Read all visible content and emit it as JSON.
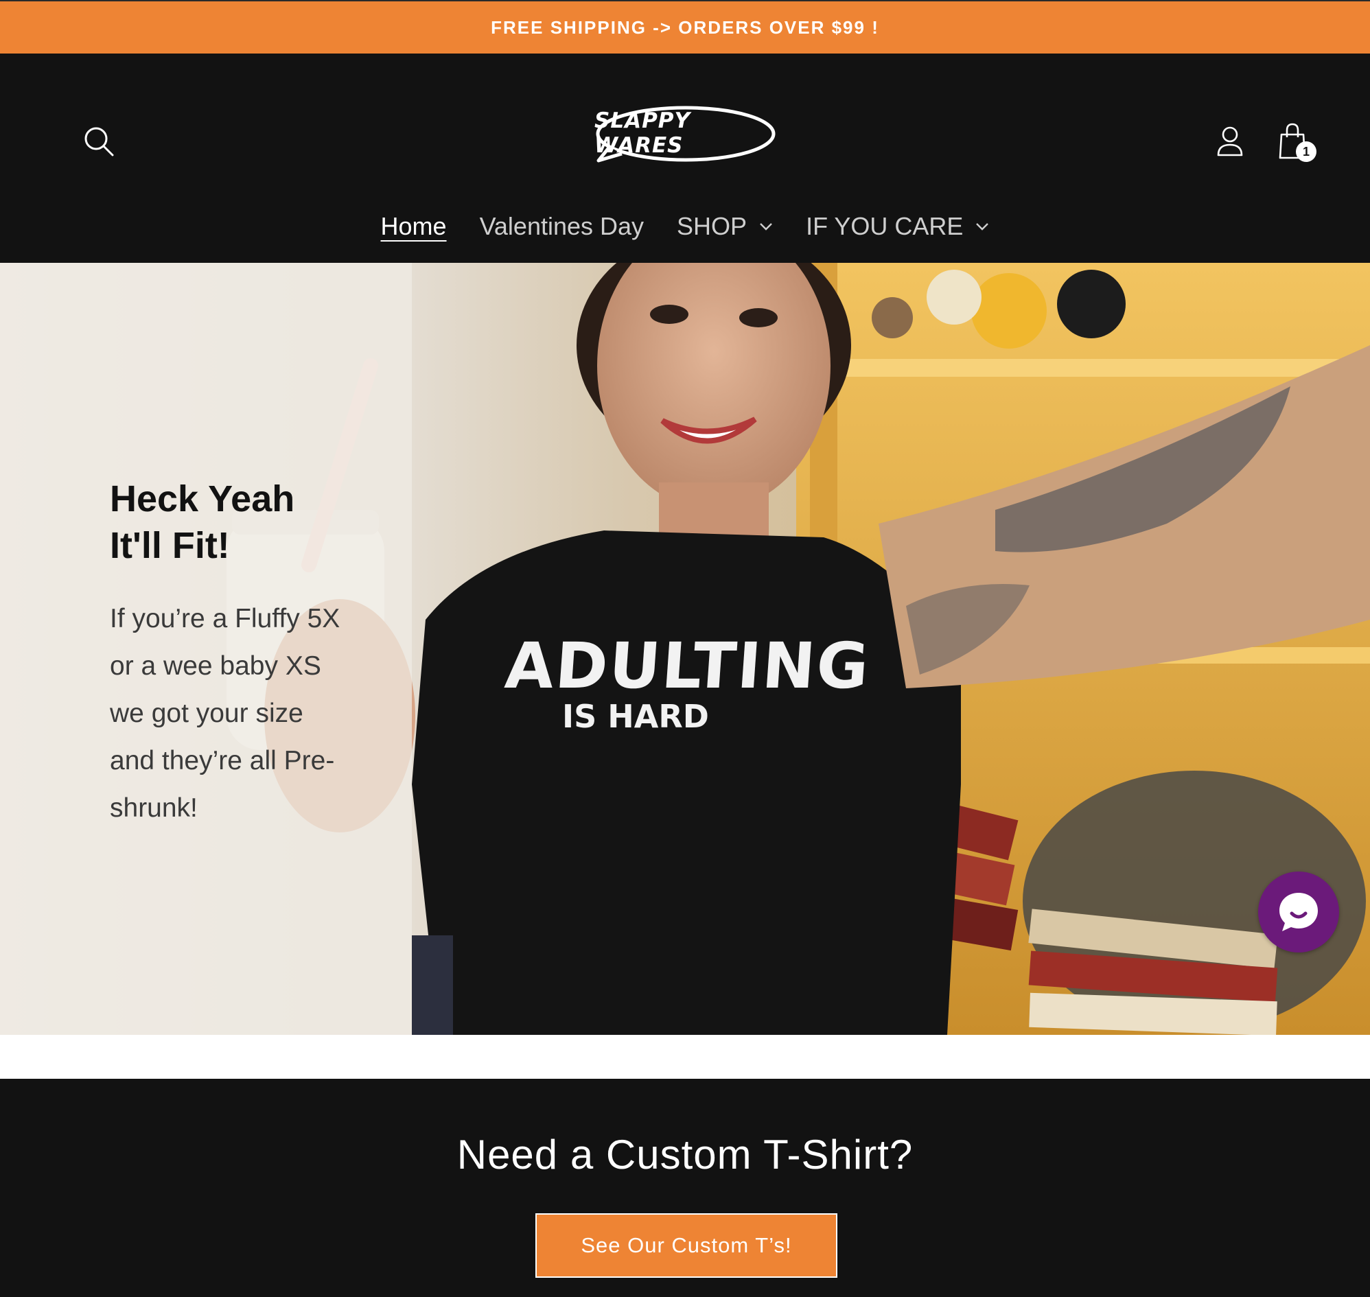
{
  "announcement": {
    "text": "FREE SHIPPING -> ORDERS OVER $99 !"
  },
  "header": {
    "logo_text": "SLAPPY WARES",
    "cart_count": "1",
    "nav": [
      {
        "label": "Home",
        "active": true
      },
      {
        "label": "Valentines Day"
      },
      {
        "label": "SHOP",
        "has_dropdown": true
      },
      {
        "label": "IF YOU CARE",
        "has_dropdown": true
      }
    ],
    "icons": [
      "search-icon",
      "account-icon",
      "cart-icon",
      "chevron-down-icon"
    ]
  },
  "hero": {
    "heading": "Heck Yeah It'll Fit!",
    "body": "If you’re a Fluffy 5X or a wee baby XS we got your size and they’re all Pre-shrunk!",
    "shirt_line1": "ADULTING",
    "shirt_line2": "IS HARD",
    "chat_icon": "chat-bubble-icon"
  },
  "cta": {
    "title": "Need a Custom T-Shirt?",
    "button_label": "See Our Custom T’s!"
  },
  "colors": {
    "accent": "#ee8434",
    "header_bg": "#121212",
    "chat": "#6b1a7a"
  }
}
